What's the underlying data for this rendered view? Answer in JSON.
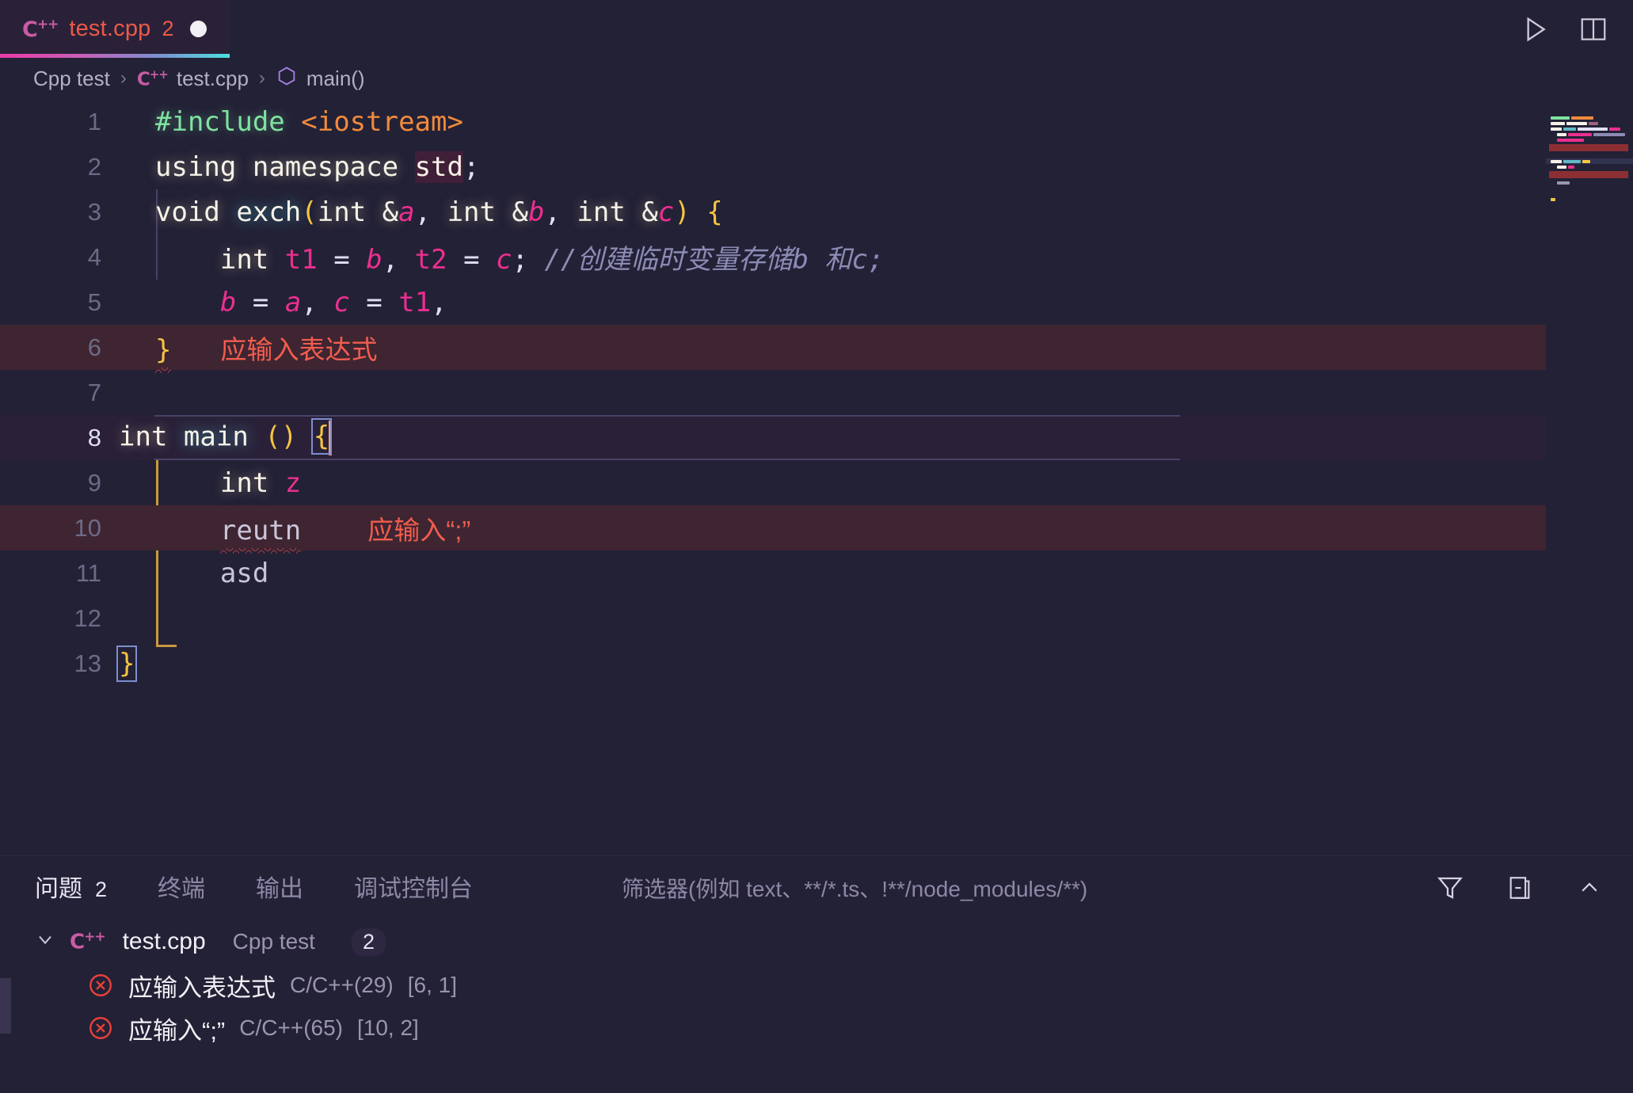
{
  "tab": {
    "lang_icon": "cpp-icon",
    "lang_label": "C",
    "lang_sup": "++",
    "title": "test.cpp",
    "badge": "2",
    "dirty_icon": "unsaved-dot-icon"
  },
  "tabbar_actions": [
    {
      "name": "run-code-icon",
      "label": "Run"
    },
    {
      "name": "split-editor-icon",
      "label": "Split Editor"
    }
  ],
  "breadcrumb": {
    "project": "Cpp test",
    "file": "test.cpp",
    "symbol": "main()",
    "separator": "›"
  },
  "editor": {
    "lines": [
      {
        "n": "1",
        "text": "#include <iostream>"
      },
      {
        "n": "2",
        "text": "using namespace std;"
      },
      {
        "n": "3",
        "text": "void exch(int &a, int &b, int &c) {"
      },
      {
        "n": "4",
        "text": "    int t1 = b, t2 = c; //创建临时变量存储b 和c;"
      },
      {
        "n": "5",
        "text": "    b = a, c = t1,"
      },
      {
        "n": "6",
        "text": "}",
        "inline_error": "应输入表达式"
      },
      {
        "n": "7",
        "text": ""
      },
      {
        "n": "8",
        "text": "int main () {"
      },
      {
        "n": "9",
        "text": "    int z"
      },
      {
        "n": "10",
        "text": "    reutn",
        "inline_error": "应输入“;”"
      },
      {
        "n": "11",
        "text": "    asd"
      },
      {
        "n": "12",
        "text": ""
      },
      {
        "n": "13",
        "text": "}"
      }
    ],
    "tokens": {
      "l1": {
        "directive": "#include",
        "header": "<iostream>"
      },
      "l2": {
        "kw1": "using",
        "kw2": "namespace",
        "id": "std",
        "semi": ";"
      },
      "l3": {
        "kw": "void",
        "fn": "exch",
        "open": "(",
        "p1a": "int",
        "p1b": "&",
        "p1c": "a",
        "c1": ", ",
        "p2a": "int",
        "p2b": "&",
        "p2c": "b",
        "c2": ", ",
        "p3a": "int",
        "p3b": "&",
        "p3c": "c",
        "close": ")",
        "brace": "{"
      },
      "l4": {
        "kw": "int",
        "v1": "t1",
        "eq": "=",
        "v2": "b",
        "comma": ",",
        "v3": "t2",
        "eq2": "=",
        "v4": "c",
        "semi": ";",
        "comment": "//创建临时变量存储b 和c;"
      },
      "l5": {
        "v1": "b",
        "eq": "=",
        "v2": "a",
        "comma": ",",
        "v3": "c",
        "eq2": "=",
        "v4": "t1",
        "comma2": ","
      },
      "l6": {
        "brace": "}"
      },
      "l8": {
        "kw": "int",
        "fn": "main",
        "parens": "()",
        "brace": "{"
      },
      "l9": {
        "kw": "int",
        "v": "z"
      },
      "l10": {
        "word": "reutn"
      },
      "l11": {
        "word": "asd"
      },
      "l13": {
        "brace": "}"
      }
    }
  },
  "panel": {
    "tabs": [
      {
        "name": "problems",
        "label": "问题",
        "count": "2",
        "active": true
      },
      {
        "name": "terminal",
        "label": "终端",
        "count": "",
        "active": false
      },
      {
        "name": "output",
        "label": "输出",
        "count": "",
        "active": false
      },
      {
        "name": "debug-console",
        "label": "调试控制台",
        "count": "",
        "active": false
      }
    ],
    "filter_placeholder": "筛选器(例如 text、**/*.ts、!**/node_modules/**)",
    "actions": [
      {
        "name": "filter-icon",
        "label": "Filter"
      },
      {
        "name": "collapse-all-icon",
        "label": "Collapse All"
      },
      {
        "name": "chevron-up-icon",
        "label": "Collapse Panel"
      }
    ],
    "file_group": {
      "chevron": "⌄",
      "lang_label": "C",
      "lang_sup": "++",
      "file": "test.cpp",
      "project": "Cpp test",
      "count": "2"
    },
    "problems": [
      {
        "icon": "error-icon",
        "message": "应输入表达式",
        "source": "C/C++(29)",
        "position": "[6, 1]"
      },
      {
        "icon": "error-icon",
        "message": "应输入“;”",
        "source": "C/C++(65)",
        "position": "[10, 2]"
      }
    ]
  },
  "colors": {
    "background": "#232136",
    "tab_active": "#2a2139",
    "error_red": "#f25d4e",
    "error_line_bg": "#3e2531",
    "accent_pink": "#eb2f8f",
    "keyword_cream": "#f6f2e8",
    "brace_yellow": "#f5c542",
    "preproc_green": "#7fe3a0",
    "string_orange": "#f08a3c",
    "comment_blue": "#8b8bb5",
    "line_number": "#6e6a86",
    "active_guide": "#c99a3d"
  }
}
